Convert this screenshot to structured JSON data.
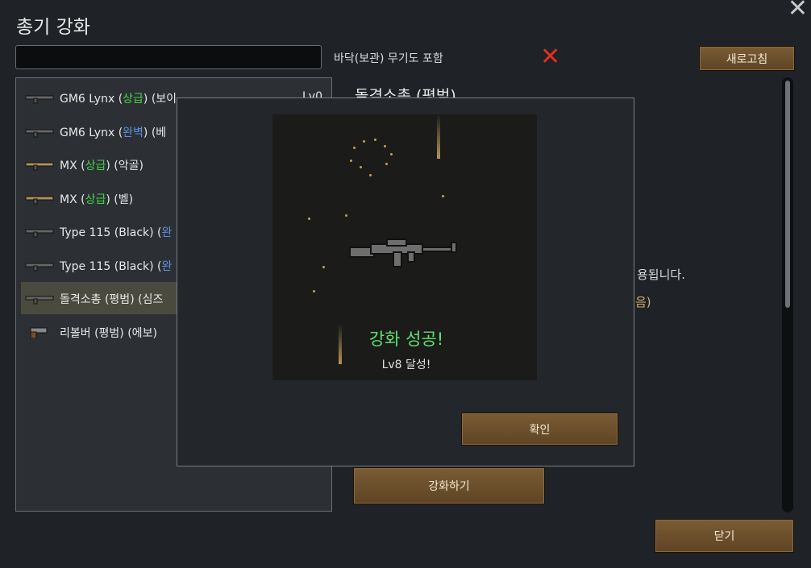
{
  "window": {
    "title": "총기 강화",
    "floor_label": "바닥(보관) 무기도 포함",
    "refresh_label": "새로고침",
    "enhance_label": "강화하기",
    "close_label": "닫기"
  },
  "search": {
    "value": "",
    "placeholder": ""
  },
  "weapon_list": [
    {
      "base": "GM6 Lynx (",
      "grade": "상급",
      "grade_color": "#44d448",
      "rest": ") (보이",
      "level": "Lv0"
    },
    {
      "base": "GM6 Lynx (",
      "grade": "완벽",
      "grade_color": "#5a90e0",
      "rest": ") (베",
      "level": ""
    },
    {
      "base": "MX (",
      "grade": "상급",
      "grade_color": "#44d448",
      "rest": ") (악골)",
      "level": ""
    },
    {
      "base": "MX (",
      "grade": "상급",
      "grade_color": "#44d448",
      "rest": ") (벨)",
      "level": ""
    },
    {
      "base": "Type 115 (Black) (",
      "grade": "완",
      "grade_color": "#5a90e0",
      "rest": "",
      "level": ""
    },
    {
      "base": "Type 115 (Black) (",
      "grade": "완",
      "grade_color": "#5a90e0",
      "rest": "",
      "level": ""
    },
    {
      "base": "돌격소총 (평범) (심즈",
      "grade": "",
      "grade_color": "",
      "rest": "",
      "level": ""
    },
    {
      "base": "리볼버 (평범) (에보)",
      "grade": "",
      "grade_color": "",
      "rest": "",
      "level": ""
    }
  ],
  "detail": {
    "title": "돌격소총 (평범)",
    "text1": "용됩니다.",
    "text2": "음)"
  },
  "modal": {
    "result_title": "강화 성공!",
    "result_sub": "Lv8 달성!",
    "ok_label": "확인"
  },
  "icons": {
    "window_close": "close-icon",
    "floor_toggle": "red-x-icon"
  },
  "colors": {
    "grade_high": "#44d448",
    "grade_perfect": "#5a90e0",
    "success": "#60e070",
    "button_bg": "#6b4f2c"
  }
}
